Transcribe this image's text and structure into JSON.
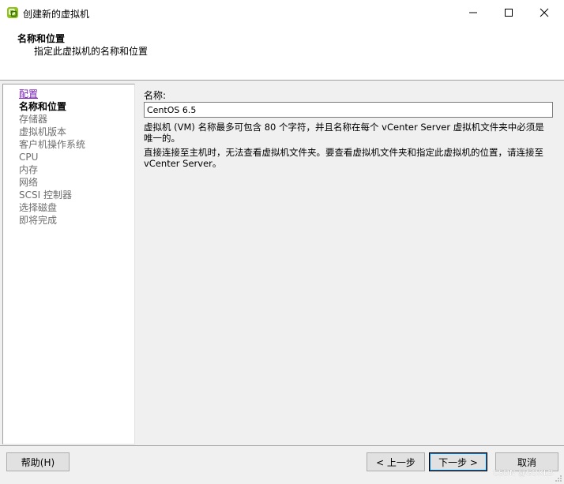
{
  "window": {
    "title": "创建新的虚拟机",
    "icon": "vmware-vsphere-icon"
  },
  "header": {
    "title": "名称和位置",
    "subtitle": "指定此虚拟机的名称和位置"
  },
  "steps": [
    {
      "label": "配置",
      "state": "link"
    },
    {
      "label": "名称和位置",
      "state": "current"
    },
    {
      "label": "存储器",
      "state": "pending"
    },
    {
      "label": "虚拟机版本",
      "state": "pending"
    },
    {
      "label": "客户机操作系统",
      "state": "pending"
    },
    {
      "label": "CPU",
      "state": "pending"
    },
    {
      "label": "内存",
      "state": "pending"
    },
    {
      "label": "网络",
      "state": "pending"
    },
    {
      "label": "SCSI 控制器",
      "state": "pending"
    },
    {
      "label": "选择磁盘",
      "state": "pending"
    },
    {
      "label": "即将完成",
      "state": "pending"
    }
  ],
  "form": {
    "name_label": "名称:",
    "name_value": "CentOS 6.5",
    "description_1": "虚拟机 (VM) 名称最多可包含 80 个字符，并且名称在每个 vCenter Server 虚拟机文件夹中必须是唯一的。",
    "description_2": "直接连接至主机时，无法查看虚拟机文件夹。要查看虚拟机文件夹和指定此虚拟机的位置，请连接至 vCenter Server。"
  },
  "footer": {
    "help_label": "帮助(H)",
    "back_label": "< 上一步",
    "next_label": "下一步 >",
    "cancel_label": "取消",
    "watermark": "CSDN @GDXLB"
  }
}
